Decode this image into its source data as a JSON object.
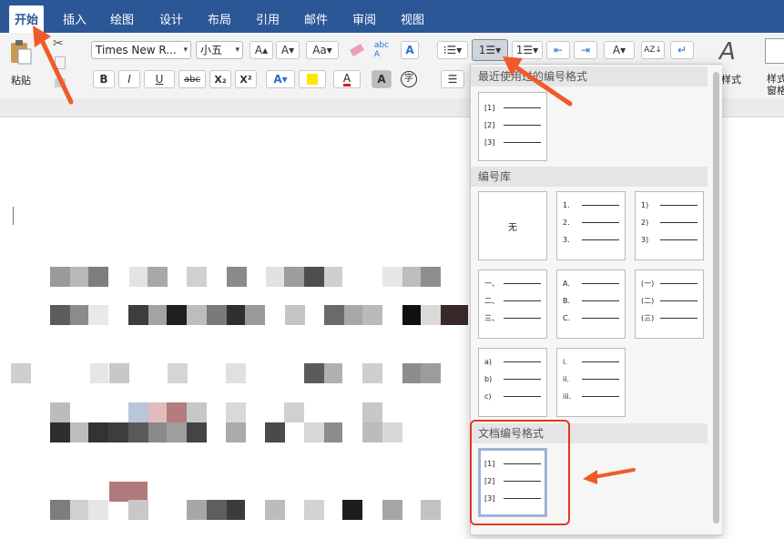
{
  "tabs": [
    "开始",
    "插入",
    "绘图",
    "设计",
    "布局",
    "引用",
    "邮件",
    "审阅",
    "视图"
  ],
  "ribbon": {
    "paste_label": "粘贴",
    "font_name": "Times New R...",
    "font_size": "小五",
    "bold": "B",
    "italic": "I",
    "underline": "U",
    "strike": "abc",
    "subscript": "X₂",
    "superscript": "X²",
    "styles_label": "样式",
    "styles_pane_label": "样式窗格"
  },
  "dropdown": {
    "recent_title": "最近使用过的编号格式",
    "library_title": "编号库",
    "doc_title": "文档编号格式",
    "none_label": "无",
    "recent_card": [
      "[1]",
      "[2]",
      "[3]"
    ],
    "library_cards": [
      [
        "1.",
        "2.",
        "3."
      ],
      [
        "1)",
        "2)",
        "3)"
      ],
      [
        "一、",
        "二、",
        "三、"
      ],
      [
        "A.",
        "B.",
        "C."
      ],
      [
        "(一)",
        "(二)",
        "(三)"
      ],
      [
        "a)",
        "b)",
        "c)"
      ],
      [
        "i.",
        "ii.",
        "iii."
      ]
    ],
    "doc_card": [
      "[1]",
      "[2]",
      "[3]"
    ]
  },
  "colors": {
    "tab_bar": "#2b5797",
    "ribbon": "#f3f3f3",
    "highlight_box": "#e0391e",
    "arrow": "#f05a2b"
  }
}
